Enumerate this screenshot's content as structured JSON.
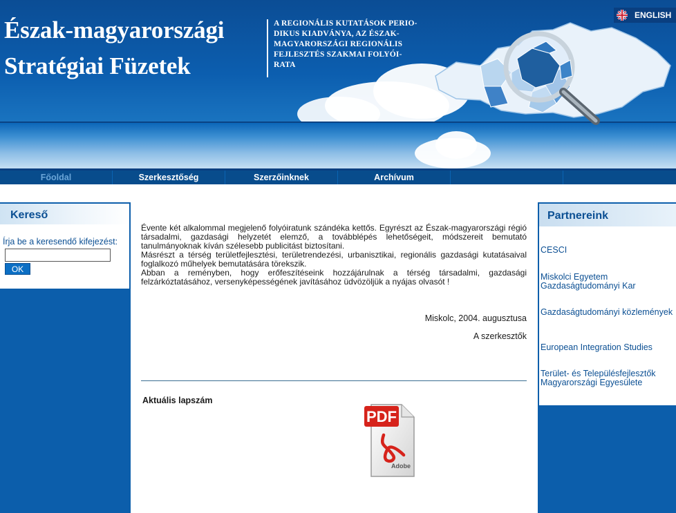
{
  "header": {
    "title_line1": "Észak-magyarországi",
    "title_line2": "Stratégiai Füzetek",
    "subtitle_lines": [
      "A REGIONÁLIS KUTATÁSOK PERIO-",
      "DIKUS KIADVÁNYA, AZ ÉSZAK-",
      "MAGYARORSZÁGI REGIONÁLIS",
      "FEJLESZTÉS SZAKMAI FOLYÓI-",
      "RATA"
    ],
    "language_link": "ENGLISH"
  },
  "nav": {
    "items": [
      {
        "label": "Főoldal",
        "active": true
      },
      {
        "label": "Szerkesztőség",
        "active": false
      },
      {
        "label": "Szerzőinknek",
        "active": false
      },
      {
        "label": "Archívum",
        "active": false
      }
    ]
  },
  "search": {
    "title": "Kereső",
    "label": "Írja be a keresendő kifejezést:",
    "input_value": "",
    "button_label": "OK"
  },
  "main": {
    "paragraphs": [
      "Évente két alkalommal megjelenő folyóiratunk szándéka kettős. Egyrészt az Észak-magyarországi régió társadalmi, gazdasági helyzetét elemző, a továbblépés lehetőségeit, módszereit bemutató tanulmányoknak kíván szélesebb publicitást biztosítani.",
      "Másrészt a térség területfejlesztési, területrendezési, urbanisztikai, regionális gazdasági kutatásaival foglalkozó műhelyek bemutatására törekszik.",
      "Abban a reményben, hogy erőfeszítéseink hozzájárulnak a térség társadalmi, gazdasági felzárkóztatásához, versenyképességének javításához üdvözöljük a nyájas olvasót !"
    ],
    "sign_place": "Miskolc, 2004. augusztusa",
    "sign_author": "A szerkesztők",
    "current_issue_title": "Aktuális lapszám",
    "pdf_icon_text": "PDF",
    "pdf_brand": "Adobe"
  },
  "partners": {
    "title": "Partnereink",
    "items": [
      "CESCI",
      "Miskolci Egyetem Gazdaságtudományi Kar",
      "Gazdaságtudományi közlemények",
      "European Integration Studies",
      "Terület- és Településfejlesztők Magyarországi Egyesülete"
    ]
  },
  "colors": {
    "header_blue": "#0b5cab",
    "nav_blue": "#084c8c",
    "nav_active_text": "#6aa5d8",
    "link_blue": "#0b4f93",
    "button_blue": "#0c6fc4",
    "pdf_red": "#d6231b"
  },
  "icons": {
    "language_flag": "uk-flag-icon",
    "current_issue": "pdf-document-icon",
    "header_art": "region-map-magnifier-icon"
  }
}
